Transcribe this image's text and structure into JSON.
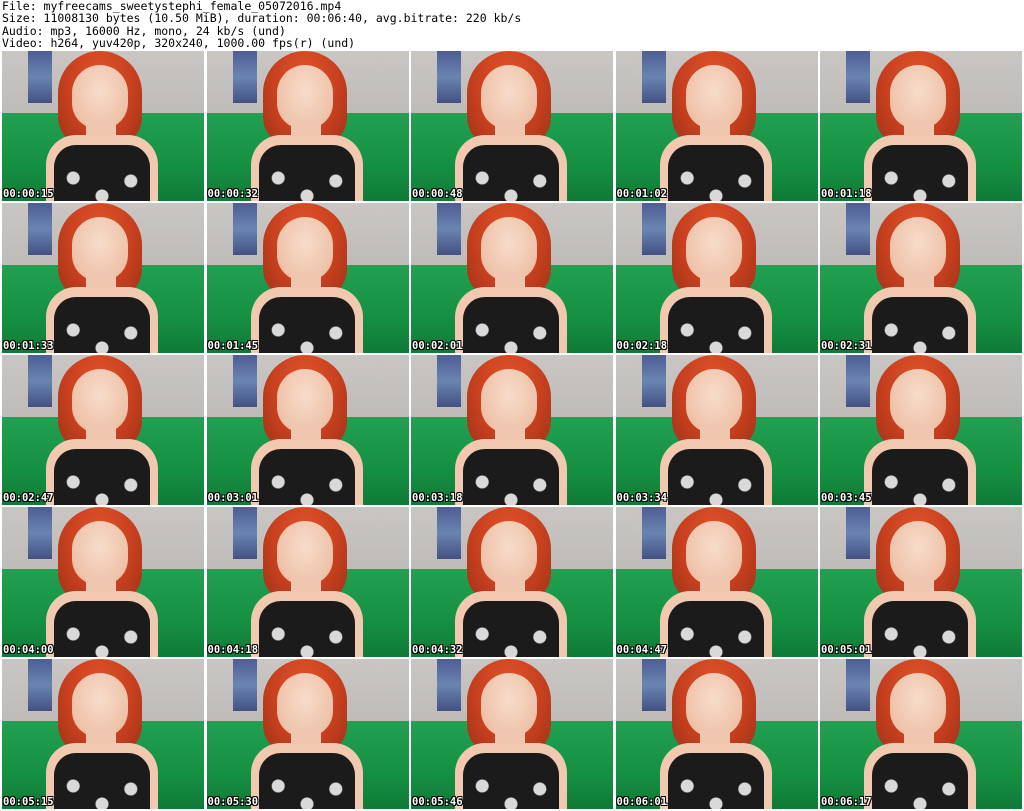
{
  "header": {
    "file_line": "File: myfreecams_sweetystephi_female_05072016.mp4",
    "size_line": "Size: 11008130 bytes (10.50 MiB), duration: 00:06:40, avg.bitrate: 220 kb/s",
    "audio_line": "Audio: mp3, 16000 Hz, mono, 24 kb/s (und)",
    "video_line": "Video: h264, yuv420p, 320x240, 1000.00 fps(r) (und)"
  },
  "thumbnails": [
    {
      "timestamp": "00:00:15"
    },
    {
      "timestamp": "00:00:32"
    },
    {
      "timestamp": "00:00:48"
    },
    {
      "timestamp": "00:01:02"
    },
    {
      "timestamp": "00:01:18"
    },
    {
      "timestamp": "00:01:33"
    },
    {
      "timestamp": "00:01:45"
    },
    {
      "timestamp": "00:02:01"
    },
    {
      "timestamp": "00:02:18"
    },
    {
      "timestamp": "00:02:31"
    },
    {
      "timestamp": "00:02:47"
    },
    {
      "timestamp": "00:03:01"
    },
    {
      "timestamp": "00:03:18"
    },
    {
      "timestamp": "00:03:34"
    },
    {
      "timestamp": "00:03:45"
    },
    {
      "timestamp": "00:04:00"
    },
    {
      "timestamp": "00:04:18"
    },
    {
      "timestamp": "00:04:32"
    },
    {
      "timestamp": "00:04:47"
    },
    {
      "timestamp": "00:05:01"
    },
    {
      "timestamp": "00:05:15"
    },
    {
      "timestamp": "00:05:30"
    },
    {
      "timestamp": "00:05:46"
    },
    {
      "timestamp": "00:06:01"
    },
    {
      "timestamp": "00:06:17"
    }
  ]
}
